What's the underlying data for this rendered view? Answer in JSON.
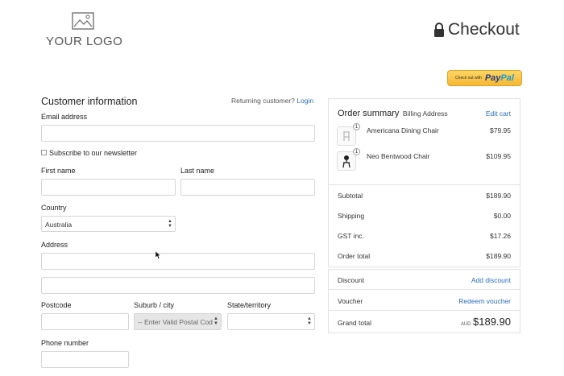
{
  "logo": {
    "text": "YOUR LOGO",
    "icon": "image-placeholder-icon"
  },
  "header": {
    "title": "Checkout",
    "icon": "lock-icon"
  },
  "paypal": {
    "prefix": "Check out with",
    "brand_pay": "Pay",
    "brand_pal": "Pal"
  },
  "customer": {
    "heading": "Customer information",
    "returning_text": "Returning customer?",
    "login_link": "Login",
    "email_label": "Email address",
    "newsletter_label": "Subscribe to our newsletter",
    "first_name_label": "First name",
    "last_name_label": "Last name",
    "country_label": "Country",
    "country_value": "Australia",
    "address_label": "Address",
    "postcode_label": "Postcode",
    "suburb_label": "Suburb / city",
    "suburb_value": "-- Enter Valid Postal Cod",
    "state_label": "State/territory",
    "phone_label": "Phone number"
  },
  "summary": {
    "heading": "Order summary",
    "subheading": "Billing Address",
    "edit_cart": "Edit cart",
    "items": [
      {
        "name": "Americana Dining Chair",
        "price": "$79.95",
        "qty": "1"
      },
      {
        "name": "Neo Bentwood Chair",
        "price": "$109.95",
        "qty": "1"
      }
    ],
    "subtotal_label": "Subtotal",
    "subtotal": "$189.90",
    "shipping_label": "Shipping",
    "shipping": "$0.00",
    "gst_label": "GST inc.",
    "gst": "$17.26",
    "order_total_label": "Order total",
    "order_total": "$189.90",
    "discount_label": "Discount",
    "add_discount": "Add discount",
    "voucher_label": "Voucher",
    "redeem_voucher": "Redeem voucher",
    "grand_total_label": "Grand total",
    "currency": "AUD",
    "grand_total": "$189.90"
  }
}
